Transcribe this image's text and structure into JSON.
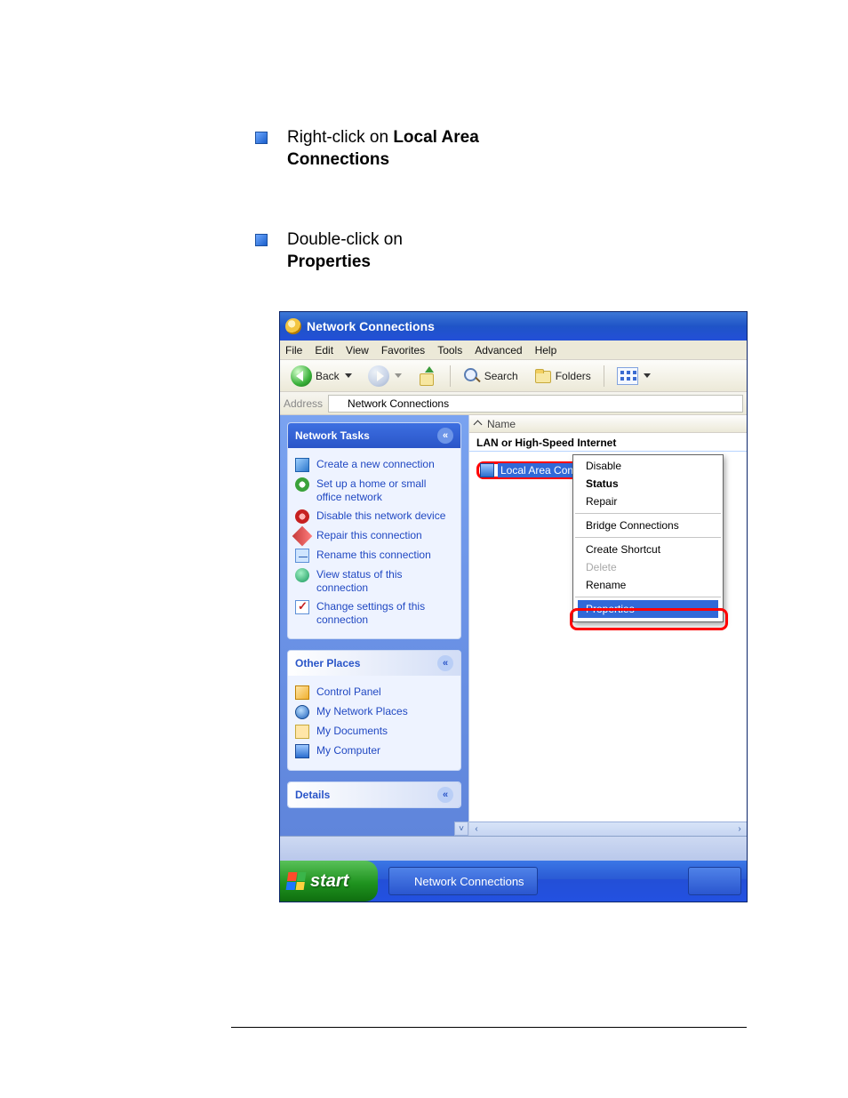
{
  "instructions": {
    "step1_prefix": "Right-click on ",
    "step1_bold": "Local Area Connections",
    "step2_prefix": "Double-click on ",
    "step2_bold": "Properties"
  },
  "window": {
    "title": "Network Connections",
    "menus": [
      "File",
      "Edit",
      "View",
      "Favorites",
      "Tools",
      "Advanced",
      "Help"
    ],
    "toolbar": {
      "back": "Back",
      "search": "Search",
      "folders": "Folders"
    },
    "addressbar": {
      "label": "Address",
      "value": "Network Connections"
    },
    "sidepane": {
      "tasks_title": "Network Tasks",
      "tasks": [
        "Create a new connection",
        "Set up a home or small office network",
        "Disable this network device",
        "Repair this connection",
        "Rename this connection",
        "View status of this connection",
        "Change settings of this connection"
      ],
      "other_title": "Other Places",
      "other": [
        "Control Panel",
        "My Network Places",
        "My Documents",
        "My Computer"
      ],
      "details_title": "Details"
    },
    "content": {
      "column_name": "Name",
      "group": "LAN or High-Speed Internet",
      "selected_item": "Local Area Con"
    },
    "context_menu": {
      "items": [
        {
          "label": "Disable",
          "style": "normal"
        },
        {
          "label": "Status",
          "style": "bold"
        },
        {
          "label": "Repair",
          "style": "normal"
        },
        {
          "label": "-",
          "style": "sep"
        },
        {
          "label": "Bridge Connections",
          "style": "normal"
        },
        {
          "label": "-",
          "style": "sep"
        },
        {
          "label": "Create Shortcut",
          "style": "normal"
        },
        {
          "label": "Delete",
          "style": "disabled"
        },
        {
          "label": "Rename",
          "style": "normal"
        },
        {
          "label": "-",
          "style": "sep"
        },
        {
          "label": "Properties",
          "style": "hl"
        }
      ]
    },
    "taskbar": {
      "start": "start",
      "button": "Network Connections"
    }
  }
}
